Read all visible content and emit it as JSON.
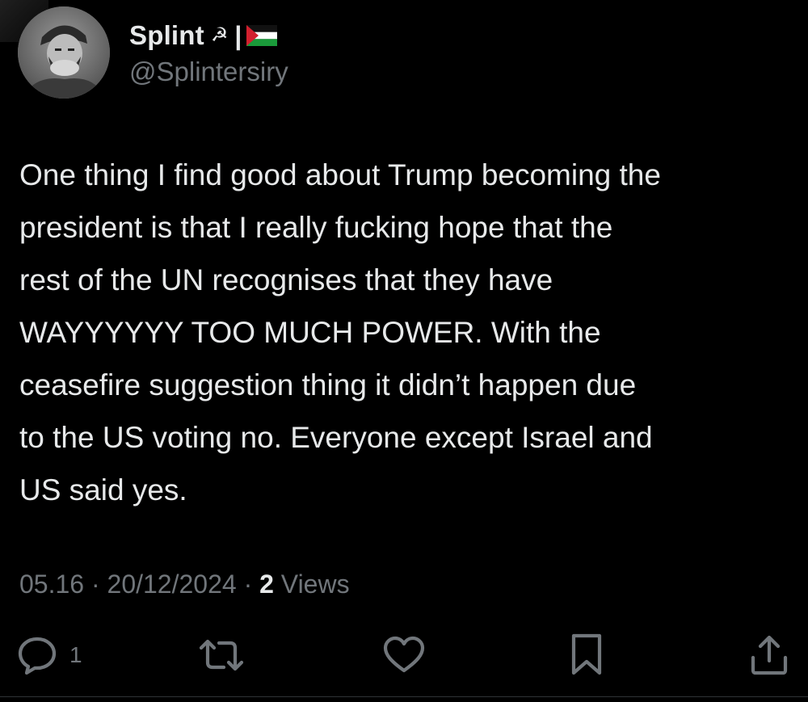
{
  "author": {
    "display_name": "Splint",
    "handle": "@Splintersiry",
    "separator": "|",
    "emoji_icons": [
      "hammer-and-sickle-icon",
      "palestine-flag-icon"
    ]
  },
  "tweet": {
    "text": "One thing I find good about Trump becoming the\npresident is that I really fucking hope that the\nrest of the UN recognises that they have\nWAYYYYYY TOO MUCH POWER. With the\nceasefire suggestion thing it didn’t happen due\nto the US voting no. Everyone except Israel and\nUS said yes.",
    "time": "05.16",
    "date": "20/12/2024",
    "separator": "·",
    "views_count": "2",
    "views_label": "Views"
  },
  "actions": {
    "reply_count": "1",
    "icons": [
      "reply-icon",
      "retweet-icon",
      "like-icon",
      "bookmark-icon",
      "share-icon"
    ]
  },
  "colors": {
    "background": "#000000",
    "primary_text": "#e7e9ea",
    "secondary_text": "#71767b"
  }
}
